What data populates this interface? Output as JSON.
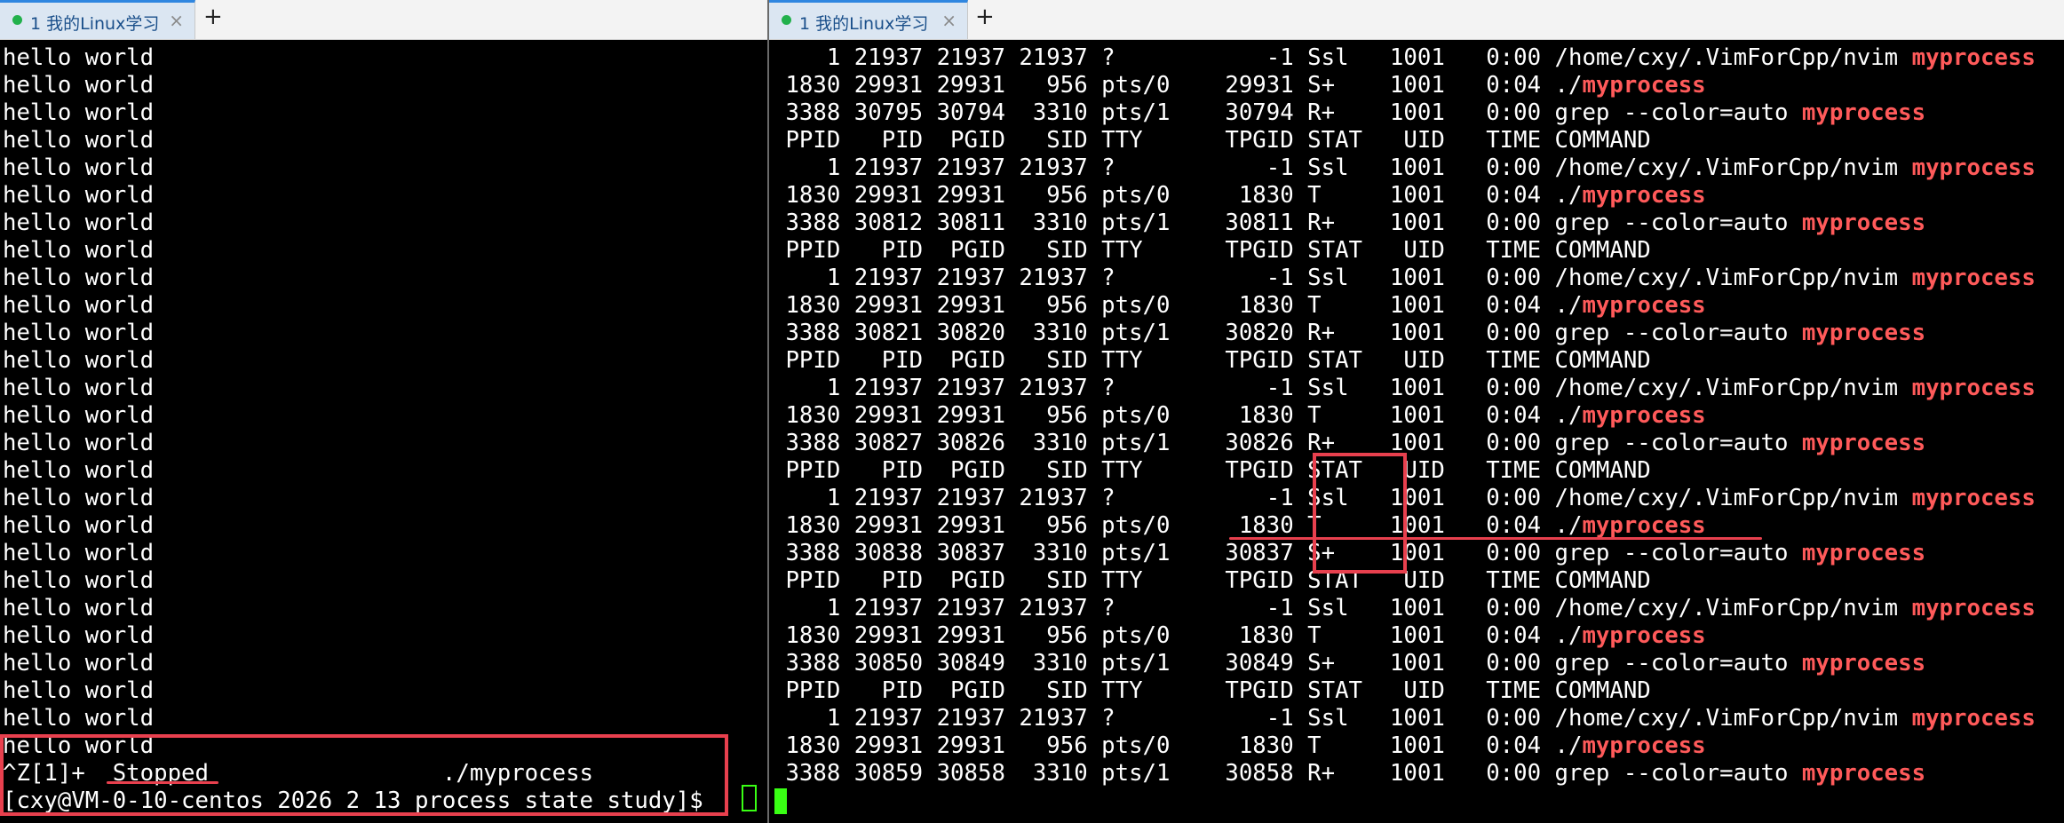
{
  "left_tab": {
    "label": "1 我的Linux学习",
    "close": "×",
    "add": "+"
  },
  "right_tab": {
    "label": "1 我的Linux学习",
    "close": "×",
    "add": "+"
  },
  "left_terminal": {
    "lines": [
      "hello world",
      "hello world",
      "hello world",
      "hello world",
      "hello world",
      "hello world",
      "hello world",
      "hello world",
      "hello world",
      "hello world",
      "hello world",
      "hello world",
      "hello world",
      "hello world",
      "hello world",
      "hello world",
      "hello world",
      "hello world",
      "hello world",
      "hello world",
      "hello world",
      "hello world",
      "hello world",
      "hello world",
      "hello world",
      "hello world",
      "^Z[1]+  Stopped                 ./myprocess",
      "[cxy@VM-0-10-centos 2026_2_13_process_state_study]$ "
    ]
  },
  "right_terminal": {
    "lines": [
      {
        "t": "    1 21937 21937 21937 ?           -1 Ssl   1001   0:00 /home/cxy/.VimForCpp/nvim ",
        "h": "myprocess"
      },
      {
        "t": " 1830 29931 29931   956 pts/0    29931 S+    1001   0:04 ./",
        "h": "myprocess"
      },
      {
        "t": " 3388 30795 30794  3310 pts/1    30794 R+    1001   0:00 grep --color=auto ",
        "h": "myprocess"
      },
      {
        "t": " PPID   PID  PGID   SID TTY      TPGID STAT   UID   TIME COMMAND",
        "h": ""
      },
      {
        "t": "    1 21937 21937 21937 ?           -1 Ssl   1001   0:00 /home/cxy/.VimForCpp/nvim ",
        "h": "myprocess"
      },
      {
        "t": " 1830 29931 29931   956 pts/0     1830 T     1001   0:04 ./",
        "h": "myprocess"
      },
      {
        "t": " 3388 30812 30811  3310 pts/1    30811 R+    1001   0:00 grep --color=auto ",
        "h": "myprocess"
      },
      {
        "t": " PPID   PID  PGID   SID TTY      TPGID STAT   UID   TIME COMMAND",
        "h": ""
      },
      {
        "t": "    1 21937 21937 21937 ?           -1 Ssl   1001   0:00 /home/cxy/.VimForCpp/nvim ",
        "h": "myprocess"
      },
      {
        "t": " 1830 29931 29931   956 pts/0     1830 T     1001   0:04 ./",
        "h": "myprocess"
      },
      {
        "t": " 3388 30821 30820  3310 pts/1    30820 R+    1001   0:00 grep --color=auto ",
        "h": "myprocess"
      },
      {
        "t": " PPID   PID  PGID   SID TTY      TPGID STAT   UID   TIME COMMAND",
        "h": ""
      },
      {
        "t": "    1 21937 21937 21937 ?           -1 Ssl   1001   0:00 /home/cxy/.VimForCpp/nvim ",
        "h": "myprocess"
      },
      {
        "t": " 1830 29931 29931   956 pts/0     1830 T     1001   0:04 ./",
        "h": "myprocess"
      },
      {
        "t": " 3388 30827 30826  3310 pts/1    30826 R+    1001   0:00 grep --color=auto ",
        "h": "myprocess"
      },
      {
        "t": " PPID   PID  PGID   SID TTY      TPGID STAT   UID   TIME COMMAND",
        "h": ""
      },
      {
        "t": "    1 21937 21937 21937 ?           -1 Ssl   1001   0:00 /home/cxy/.VimForCpp/nvim ",
        "h": "myprocess"
      },
      {
        "t": " 1830 29931 29931   956 pts/0     1830 T     1001   0:04 ./",
        "h": "myprocess"
      },
      {
        "t": " 3388 30838 30837  3310 pts/1    30837 S+    1001   0:00 grep --color=auto ",
        "h": "myprocess"
      },
      {
        "t": " PPID   PID  PGID   SID TTY      TPGID STAT   UID   TIME COMMAND",
        "h": ""
      },
      {
        "t": "    1 21937 21937 21937 ?           -1 Ssl   1001   0:00 /home/cxy/.VimForCpp/nvim ",
        "h": "myprocess"
      },
      {
        "t": " 1830 29931 29931   956 pts/0     1830 T     1001   0:04 ./",
        "h": "myprocess"
      },
      {
        "t": " 3388 30850 30849  3310 pts/1    30849 S+    1001   0:00 grep --color=auto ",
        "h": "myprocess"
      },
      {
        "t": " PPID   PID  PGID   SID TTY      TPGID STAT   UID   TIME COMMAND",
        "h": ""
      },
      {
        "t": "    1 21937 21937 21937 ?           -1 Ssl   1001   0:00 /home/cxy/.VimForCpp/nvim ",
        "h": "myprocess"
      },
      {
        "t": " 1830 29931 29931   956 pts/0     1830 T     1001   0:04 ./",
        "h": "myprocess"
      },
      {
        "t": " 3388 30859 30858  3310 pts/1    30858 R+    1001   0:00 grep --color=auto ",
        "h": "myprocess"
      }
    ]
  },
  "colors": {
    "background": "#000000",
    "text": "#ffffff",
    "highlight": "#ff5a5a",
    "annotation": "#e8404e",
    "cursor": "#39ff14",
    "tab_accent": "#2f86e0"
  }
}
